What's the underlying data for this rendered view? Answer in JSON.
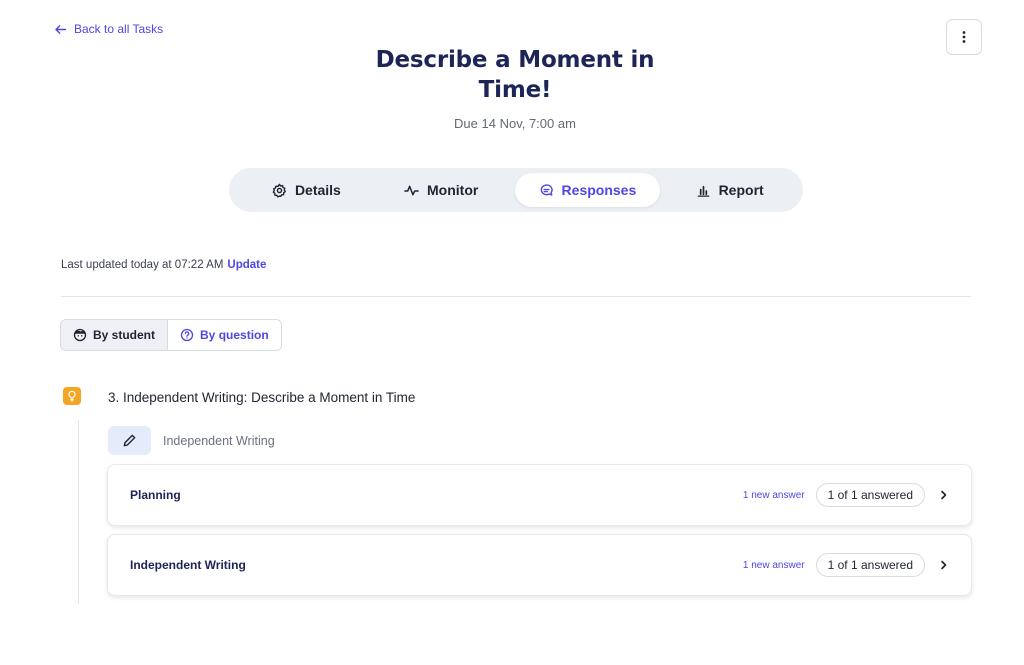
{
  "header": {
    "back_label": "Back to all Tasks",
    "title": "Describe a Moment in Time!",
    "due": "Due 14 Nov, 7:00 am"
  },
  "tabs": [
    {
      "label": "Details",
      "icon": "gear-icon"
    },
    {
      "label": "Monitor",
      "icon": "pulse-icon"
    },
    {
      "label": "Responses",
      "icon": "chat-icon",
      "active": true
    },
    {
      "label": "Report",
      "icon": "bar-chart-icon"
    }
  ],
  "status": {
    "updated_text": "Last updated today at 07:22 AM",
    "update_link": "Update"
  },
  "view_toggle": {
    "by_student": "By student",
    "by_question": "By question",
    "selected": "By student"
  },
  "section": {
    "title": "3. Independent Writing: Describe a Moment in Time",
    "activity_label": "Independent Writing",
    "items": [
      {
        "name": "Planning",
        "new_label": "1 new answer",
        "answered": "1 of 1 answered"
      },
      {
        "name": "Independent Writing",
        "new_label": "1 new answer",
        "answered": "1 of 1 answered"
      }
    ]
  },
  "colors": {
    "accent": "#4f46e5",
    "title": "#1d2456",
    "tab_bg": "#eceff4",
    "bulb": "#f5a524"
  }
}
